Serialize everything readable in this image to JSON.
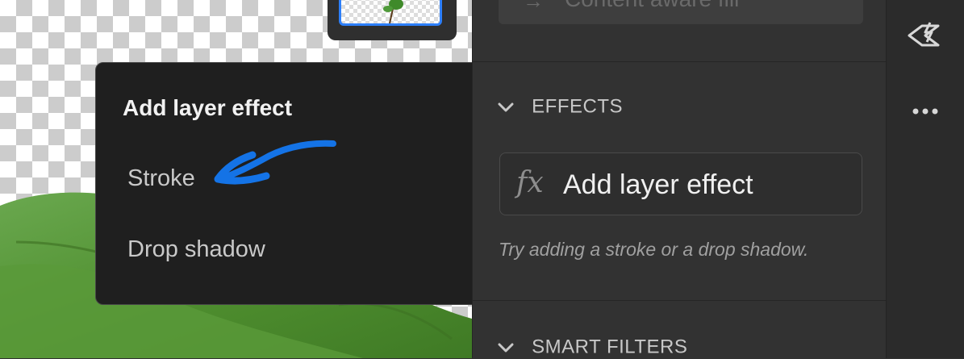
{
  "canvas": {
    "thumbnail_label": "layer-thumbnail"
  },
  "panel": {
    "top_button": {
      "label": "Content aware fill",
      "icon": "arrow-right-icon"
    },
    "effects_section": {
      "title": "EFFECTS",
      "add_button_icon": "fx",
      "add_button_label": "Add layer effect",
      "hint": "Try adding a stroke or a drop shadow."
    },
    "smart_filters_section": {
      "title": "SMART FILTERS"
    }
  },
  "toolbar": {
    "tools": [
      "eraser-lightning-icon",
      "more-icon"
    ]
  },
  "popover": {
    "title": "Add layer effect",
    "items": [
      {
        "label": "Stroke"
      },
      {
        "label": "Drop shadow"
      }
    ]
  },
  "colors": {
    "accent": "#2d7ff9",
    "annotation": "#1473e6",
    "panel_bg": "#323232",
    "popover_bg": "#1f1f1f"
  }
}
